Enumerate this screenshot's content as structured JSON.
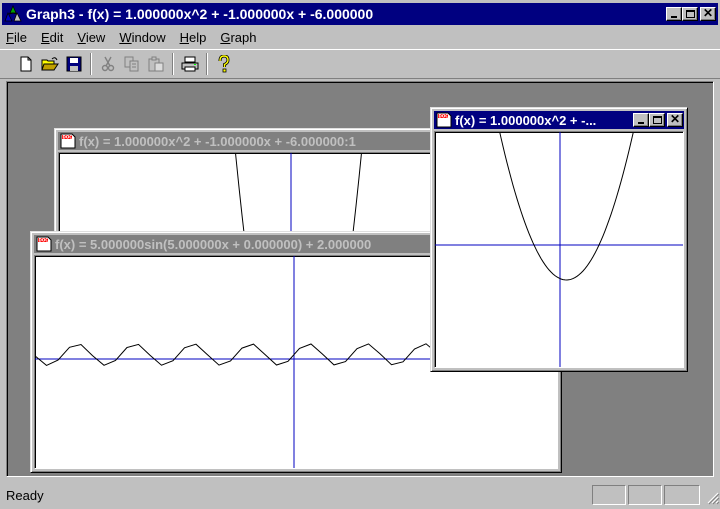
{
  "app": {
    "title": "Graph3 - f(x) = 1.000000x^2 + -1.000000x + -6.000000"
  },
  "menu": {
    "items": [
      {
        "label": "File",
        "accel": "F",
        "rest": "ile"
      },
      {
        "label": "Edit",
        "accel": "E",
        "rest": "dit"
      },
      {
        "label": "View",
        "accel": "V",
        "rest": "iew"
      },
      {
        "label": "Window",
        "accel": "W",
        "rest": "indow"
      },
      {
        "label": "Help",
        "accel": "H",
        "rest": "elp"
      },
      {
        "label": "Graph",
        "accel": "G",
        "rest": "raph"
      }
    ]
  },
  "toolbar": {
    "buttons": [
      "new-icon",
      "open-icon",
      "save-icon",
      "cut-icon",
      "copy-icon",
      "paste-icon",
      "print-icon",
      "help-icon"
    ]
  },
  "windows": {
    "parabola_back": {
      "title": "f(x) = 1.000000x^2 + -1.000000x + -6.000000:1",
      "function": "1.000000x^2 + -1.000000x + -6.000000",
      "state": "inactive"
    },
    "sine": {
      "title": "f(x) = 5.000000sin(5.000000x + 0.000000) + 2.000000",
      "function": "5.000000sin(5.000000x + 0.000000) + 2.000000",
      "state": "inactive"
    },
    "parabola_front": {
      "title": "f(x) = 1.000000x^2 + -...",
      "function": "1.000000x^2 + -1.000000x + -6.000000",
      "state": "active"
    }
  },
  "status": {
    "text": "Ready"
  },
  "colors": {
    "active_title": "#000080",
    "inactive_title": "#808080",
    "axis": "#0000c0",
    "curve": "#000000",
    "mdi_background": "#808080"
  }
}
